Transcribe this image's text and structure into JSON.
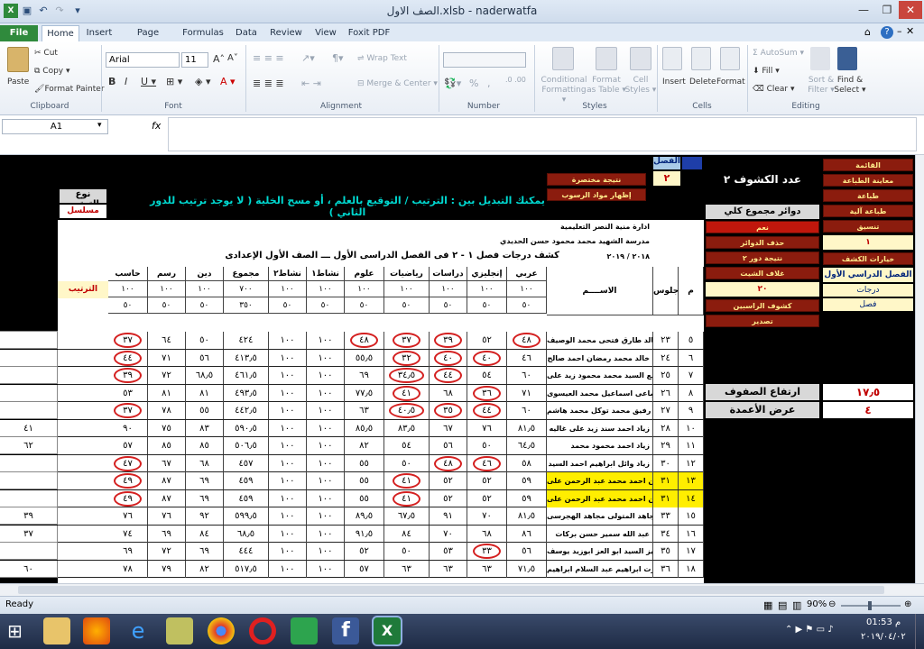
{
  "window": {
    "title": "الصف الاول.xlsb - naderwatfa"
  },
  "tabs": [
    "File",
    "Home",
    "Insert",
    "Page Layout",
    "Formulas",
    "Data",
    "Review",
    "View",
    "Foxit PDF"
  ],
  "ribbon": {
    "clipboard": {
      "paste": "Paste",
      "cut": "Cut",
      "copy": "Copy ▾",
      "format_painter": "Format Painter",
      "label": "Clipboard"
    },
    "font": {
      "name": "Arial",
      "size": "11",
      "label": "Font"
    },
    "alignment": {
      "wrap": "Wrap Text",
      "merge": "Merge & Center ▾",
      "label": "Alignment"
    },
    "number": {
      "label": "Number",
      "percent": "%",
      "comma": ","
    },
    "styles": {
      "conditional": "Conditional\nFormatting ▾",
      "format_table": "Format\nas Table ▾",
      "cell_styles": "Cell\nStyles ▾",
      "label": "Styles"
    },
    "cells": {
      "insert": "Insert",
      "delete": "Delete",
      "format": "Format",
      "label": "Cells"
    },
    "editing": {
      "autosum": "AutoSum ▾",
      "fill": "Fill ▾",
      "clear": "Clear ▾",
      "sort": "Sort &\nFilter ▾",
      "find": "Find &\nSelect ▾",
      "label": "Editing"
    }
  },
  "formula_bar": {
    "name_box": "A1",
    "fx": "fx",
    "formula": ""
  },
  "sheet": {
    "banner": "يمكنك التبديل بين : الترتيب / التوقيع بالعلم ، أو مسح الخلية ( لا يوجد ترتيب للدور الثاني )",
    "sort_type_label": "نوع الترتيب",
    "sort_type_value": "مسلسل",
    "class_label": "الفصل",
    "class_value": "٢",
    "short_result": "نتيجة مختصرة",
    "show_failed": "إظهار مواد الرسوب",
    "sheets_title": "عدد الكشوف ٢",
    "circles_total": "دوائر مجموع كلي",
    "yes": "نعم",
    "delete_circles": "حذف الدوائر",
    "delete_value": "١",
    "result_round2": "نتيجة دور ٢",
    "sheet_options": "خيارات الكشف",
    "sheet_cover": "غلاف الشيت",
    "term": "الفصل الدراسي الأول",
    "grades": "درجات",
    "grade_val": "٢٠",
    "failed_sheets": "كشوف الراسبين",
    "class_word": "فصل",
    "export": "تصدير",
    "menu": [
      "القائمة",
      "معاينة الطباعة",
      "طباعة",
      "طباعة آلية",
      "تنسيق"
    ],
    "row_height_label": "ارتفاع الصفوف",
    "row_height_value": "١٧٫٥",
    "col_width_label": "عرض الأعمدة",
    "col_width_value": "٤",
    "admin": "ادارة منية النصر التعليمية",
    "school": "مدرسة الشهيد محمد محمود حسن الحديدي",
    "year": "٢٠١٨ / ٢٠١٩",
    "report_title": "كشف درجات فصل ١ - ٢ فى الفصل الدراسى الأول   ـــ   الصف الأول الإعدادى",
    "headers": [
      "م",
      "جلوس",
      "الاســــم",
      "عربي",
      "إنجليزي",
      "دراسات",
      "رياضيات",
      "علوم",
      "نشاط١",
      "نشاط٢",
      "مجموع",
      "دين",
      "رسم",
      "حاسب"
    ],
    "rank_header": "الترتيب",
    "max": [
      "١٠٠",
      "١٠٠",
      "١٠٠",
      "١٠٠",
      "١٠٠",
      "١٠٠",
      "١٠٠",
      "٧٠٠",
      "١٠٠",
      "١٠٠",
      "١٠٠"
    ],
    "min": [
      "٥٠",
      "٥٠",
      "٥٠",
      "٥٠",
      "٥٠",
      "٥٠",
      "٥٠",
      "٣٥٠",
      "٥٠",
      "٥٠",
      "٥٠"
    ],
    "rows": [
      {
        "m": "٥",
        "seat": "٢٣",
        "name": "خالد طارق فتحى محمد الوصيف",
        "v": [
          "٤٨",
          "٥٢",
          "٣٩",
          "٣٧",
          "٤٨",
          "١٠٠",
          "١٠٠",
          "٤٢٤",
          "٥٠",
          "٦٤",
          "٣٧"
        ],
        "circ": [
          0,
          2,
          3,
          4,
          10
        ],
        "hl": false,
        "rank": ""
      },
      {
        "m": "٦",
        "seat": "٢٤",
        "name": "خالد محمد رمضان احمد صالح",
        "v": [
          "٤٦",
          "٤٠",
          "٤٠",
          "٣٢",
          "٥٥٫٥",
          "١٠٠",
          "١٠٠",
          "٤١٣٫٥",
          "٥٦",
          "٧١",
          "٤٤"
        ],
        "circ": [
          1,
          2,
          3,
          10
        ],
        "hl": false,
        "rank": ""
      },
      {
        "m": "٧",
        "seat": "٢٥",
        "name": "ربيع السيد محمد محمود زيد على",
        "v": [
          "٦٠",
          "٥٤",
          "٤٤",
          "٣٤٫٥",
          "٦٩",
          "١٠٠",
          "١٠٠",
          "٤٦١٫٥",
          "٦٨٫٥",
          "٧٢",
          "٣٩"
        ],
        "circ": [
          2,
          3,
          10
        ],
        "hl": false,
        "rank": ""
      },
      {
        "m": "٨",
        "seat": "٢٦",
        "name": "رضا الصباعى اسماعيل محمد العيسوى",
        "v": [
          "٧١",
          "٣٦",
          "٦٨",
          "٤١",
          "٧٧٫٥",
          "١٠٠",
          "١٠٠",
          "٤٩٣٫٥",
          "٨١",
          "٨١",
          "٥٣"
        ],
        "circ": [
          1,
          3
        ],
        "hl": false,
        "rank": ""
      },
      {
        "m": "٩",
        "seat": "٢٧",
        "name": "رفيق محمد توكل محمد هاشم",
        "v": [
          "٦٠",
          "٤٤",
          "٣٥",
          "٤٠٫٥",
          "٦٣",
          "١٠٠",
          "١٠٠",
          "٤٤٢٫٥",
          "٥٥",
          "٧٨",
          "٣٧"
        ],
        "circ": [
          1,
          2,
          3,
          10
        ],
        "hl": false,
        "rank": ""
      },
      {
        "m": "١٠",
        "seat": "٢٨",
        "name": "زياد احمد سند زيد على غاليه",
        "v": [
          "٨١٫٥",
          "٧٦",
          "٦٧",
          "٨٣٫٥",
          "٨٥٫٥",
          "١٠٠",
          "١٠٠",
          "٥٩٠٫٥",
          "٨٣",
          "٧٥",
          "٩٠"
        ],
        "circ": [],
        "hl": false,
        "rank": "٤١"
      },
      {
        "m": "١١",
        "seat": "٢٩",
        "name": "زياد احمد محمود محمد",
        "v": [
          "٦٤٫٥",
          "٥٠",
          "٥٦",
          "٥٤",
          "٨٢",
          "١٠٠",
          "١٠٠",
          "٥٠٦٫٥",
          "٨٥",
          "٨٥",
          "٥٧"
        ],
        "circ": [],
        "hl": false,
        "rank": "٦٢"
      },
      {
        "m": "١٢",
        "seat": "٣٠",
        "name": "زياد وائل ابراهيم احمد السيد",
        "v": [
          "٥٨",
          "٤٦",
          "٤٨",
          "٥٠",
          "٥٥",
          "١٠٠",
          "١٠٠",
          "٤٥٧",
          "٦٨",
          "٦٧",
          "٤٧"
        ],
        "circ": [
          1,
          2,
          10
        ],
        "hl": false,
        "rank": ""
      },
      {
        "m": "١٣",
        "seat": "٣١",
        "name": "عبد الرحمن احمد محمد عبد الرحمن على",
        "v": [
          "٥٩",
          "٥٢",
          "٥٢",
          "٤١",
          "٥٥",
          "١٠٠",
          "١٠٠",
          "٤٥٩",
          "٦٩",
          "٨٧",
          "٤٩"
        ],
        "circ": [
          3,
          10
        ],
        "hl": true,
        "rank": ""
      },
      {
        "m": "١٤",
        "seat": "٣١",
        "name": "عبد الرحمن احمد محمد عبد الرحمن على",
        "v": [
          "٥٩",
          "٥٢",
          "٥٢",
          "٤١",
          "٥٥",
          "١٠٠",
          "١٠٠",
          "٤٥٩",
          "٦٩",
          "٨٧",
          "٤٩"
        ],
        "circ": [
          3,
          10
        ],
        "hl": true,
        "rank": ""
      },
      {
        "m": "١٥",
        "seat": "٣٣",
        "name": "عبد الرحمن مجاهد المتولى مجاهد الهجرسى",
        "v": [
          "٨١٫٥",
          "٧٠",
          "٩١",
          "٦٧٫٥",
          "٨٩٫٥",
          "١٠٠",
          "١٠٠",
          "٥٩٩٫٥",
          "٩٢",
          "٧٦",
          "٧٦"
        ],
        "circ": [],
        "hl": false,
        "rank": "٣٩"
      },
      {
        "m": "١٦",
        "seat": "٣٤",
        "name": "عبد الله سمير حسن بركات",
        "v": [
          "٨٦",
          "٦٨",
          "٧٠",
          "٨٤",
          "٩١٫٥",
          "١٠٠",
          "١٠٠",
          "٦٨٫٥",
          "٨٤",
          "٦٩",
          "٧٤"
        ],
        "circ": [],
        "hl": false,
        "rank": "٣٧"
      },
      {
        "m": "١٧",
        "seat": "٣٥",
        "name": "عزيز السيد ابو العز ابوزيد يوسف",
        "v": [
          "٥٦",
          "٣٣",
          "٥٣",
          "٥٠",
          "٥٢",
          "١٠٠",
          "١٠٠",
          "٤٤٤",
          "٦٩",
          "٧٢",
          "٦٩"
        ],
        "circ": [
          1
        ],
        "hl": false,
        "rank": ""
      },
      {
        "m": "١٨",
        "seat": "٣٦",
        "name": "علاء عزت ابراهيم عبد السلام ابراهيم",
        "v": [
          "٧١٫٥",
          "٦٣",
          "٦٣",
          "٦٣",
          "٥٧",
          "١٠٠",
          "١٠٠",
          "٥١٧٫٥",
          "٨٢",
          "٧٩",
          "٧٨"
        ],
        "circ": [],
        "hl": false,
        "rank": "٦٠"
      }
    ]
  },
  "status": {
    "ready": "Ready",
    "zoom": "90%"
  },
  "clock": {
    "time": "01:53 م",
    "date": "٢٠١٩/٠٤/٠٢"
  }
}
